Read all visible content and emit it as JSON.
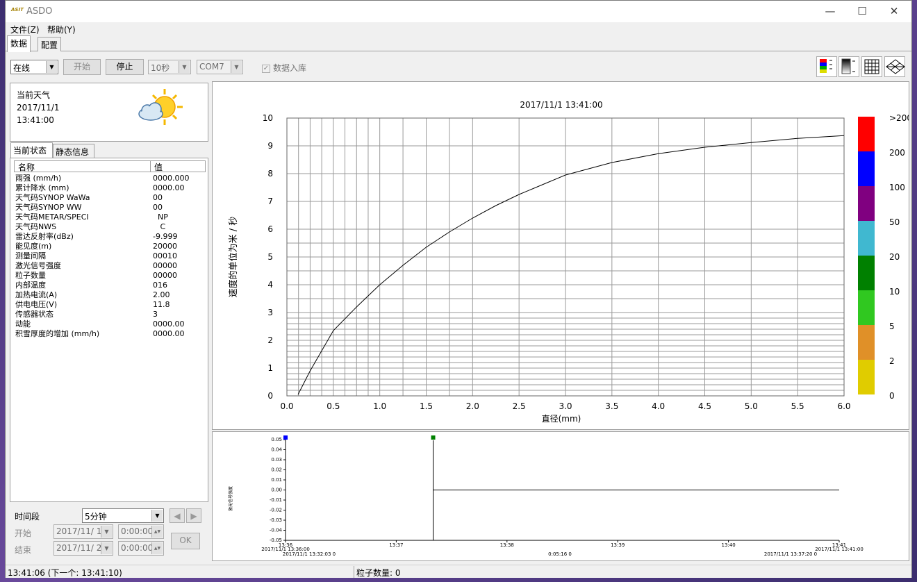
{
  "window": {
    "title": "ASDO",
    "icon": "app-logo-icon"
  },
  "menu": {
    "file": "文件(Z)",
    "help": "帮助(Y)"
  },
  "tabs": {
    "data": "数据",
    "config": "配置"
  },
  "toolbar": {
    "mode": "在线",
    "start": "开始",
    "stop": "停止",
    "interval": "10秒",
    "port": "COM7",
    "db_checkbox": "数据入库",
    "db_checked": true,
    "icons": [
      "color-scale-icon",
      "grayscale-icon",
      "grid-icon",
      "3d-view-icon"
    ]
  },
  "weather": {
    "title": "当前天气",
    "date": "2017/11/1",
    "time": "13:41:00",
    "icon": "partly-cloudy-icon"
  },
  "status_tabs": {
    "current": "当前状态",
    "static": "静态信息"
  },
  "status_table": {
    "col_name": "名称",
    "col_value": "值",
    "rows": [
      {
        "k": "雨强 (mm/h)",
        "v": "0000.000"
      },
      {
        "k": "累计降水 (mm)",
        "v": "0000.00"
      },
      {
        "k": "天气码SYNOP WaWa",
        "v": "00"
      },
      {
        "k": "天气码SYNOP WW",
        "v": "00"
      },
      {
        "k": "天气码METAR/SPECI",
        "v": "  NP"
      },
      {
        "k": "天气码NWS",
        "v": "   C"
      },
      {
        "k": "雷达反射率(dBz)",
        "v": "-9.999"
      },
      {
        "k": "能见度(m)",
        "v": "20000"
      },
      {
        "k": "测量间隔",
        "v": "00010"
      },
      {
        "k": "激光信号强度",
        "v": "00000"
      },
      {
        "k": "粒子数量",
        "v": "00000"
      },
      {
        "k": "内部温度",
        "v": "016"
      },
      {
        "k": "加热电流(A)",
        "v": "2.00"
      },
      {
        "k": "供电电压(V)",
        "v": "11.8"
      },
      {
        "k": "传感器状态",
        "v": "3"
      },
      {
        "k": "动能",
        "v": "0000.00"
      },
      {
        "k": "积雪厚度的增加 (mm/h)",
        "v": "0000.00"
      }
    ]
  },
  "time_range": {
    "label": "时间段",
    "value": "5分钟",
    "start_label": "开始",
    "start_date": "2017/11/ 1",
    "start_time": "0:00:00",
    "end_label": "结束",
    "end_date": "2017/11/ 2",
    "end_time": "0:00:00",
    "ok": "OK"
  },
  "status_bar": {
    "time": "13:41:06 (下一个: 13:41:10)",
    "particles": "粒子数量: 0"
  },
  "chart_data": [
    {
      "type": "line",
      "title": "2017/11/1  13:41:00",
      "xlabel": "直径(mm)",
      "ylabel": "速度的单位为米 / 秒",
      "xlim": [
        0,
        6
      ],
      "ylim": [
        0,
        10
      ],
      "xticks": [
        "0.0",
        "0.5",
        "1.0",
        "1.5",
        "2.0",
        "2.5",
        "3.0",
        "3.5",
        "4.0",
        "4.5",
        "5.0",
        "5.5",
        "6.0"
      ],
      "yticks": [
        "0",
        "1",
        "2",
        "3",
        "4",
        "5",
        "6",
        "7",
        "8",
        "9",
        "10"
      ],
      "grid": true,
      "curve": {
        "x": [
          0.12,
          0.25,
          0.5,
          0.75,
          1.0,
          1.25,
          1.5,
          1.75,
          2.0,
          2.25,
          2.5,
          2.75,
          3.0,
          3.5,
          4.0,
          4.5,
          5.0,
          5.5,
          6.0
        ],
        "y": [
          0.05,
          0.9,
          2.35,
          3.2,
          4.0,
          4.7,
          5.35,
          5.9,
          6.4,
          6.85,
          7.25,
          7.6,
          7.95,
          8.4,
          8.72,
          8.95,
          9.12,
          9.27,
          9.37
        ]
      },
      "legend_scale": {
        "labels": [
          ">200",
          "200",
          "100",
          "50",
          "20",
          "10",
          "5",
          "2",
          "0"
        ],
        "colors": [
          "#ff0000",
          "#0000ff",
          "#800080",
          "#40b8d0",
          "#008000",
          "#30c820",
          "#e09028",
          "#e0cc00"
        ]
      }
    },
    {
      "type": "line",
      "ylabel": "激光信号强度",
      "ylim": [
        -0.05,
        0.05
      ],
      "yticks": [
        "0.05",
        "0.04",
        "0.03",
        "0.02",
        "0.01",
        "0.00",
        "-0.01",
        "-0.02",
        "-0.03",
        "-0.04",
        "-0.05"
      ],
      "xticks": [
        "13:36",
        "13:37",
        "13:38",
        "13:39",
        "13:40",
        "13:41"
      ],
      "x_start_label": "2017/11/1 13:36:00",
      "x_end_label": "2017/11/1 13:41:00",
      "footer": [
        "2017/11/1 13:32:03  0",
        "0:05:16  0",
        "2017/11/1 13:37:20  0"
      ],
      "series": [
        {
          "x": [
            "13:37:20",
            "13:41:00"
          ],
          "y": [
            0,
            0
          ]
        }
      ],
      "markers": [
        {
          "x": "13:36:00",
          "color": "#0000ff"
        },
        {
          "x": "13:37:20",
          "color": "#008000"
        }
      ]
    }
  ]
}
